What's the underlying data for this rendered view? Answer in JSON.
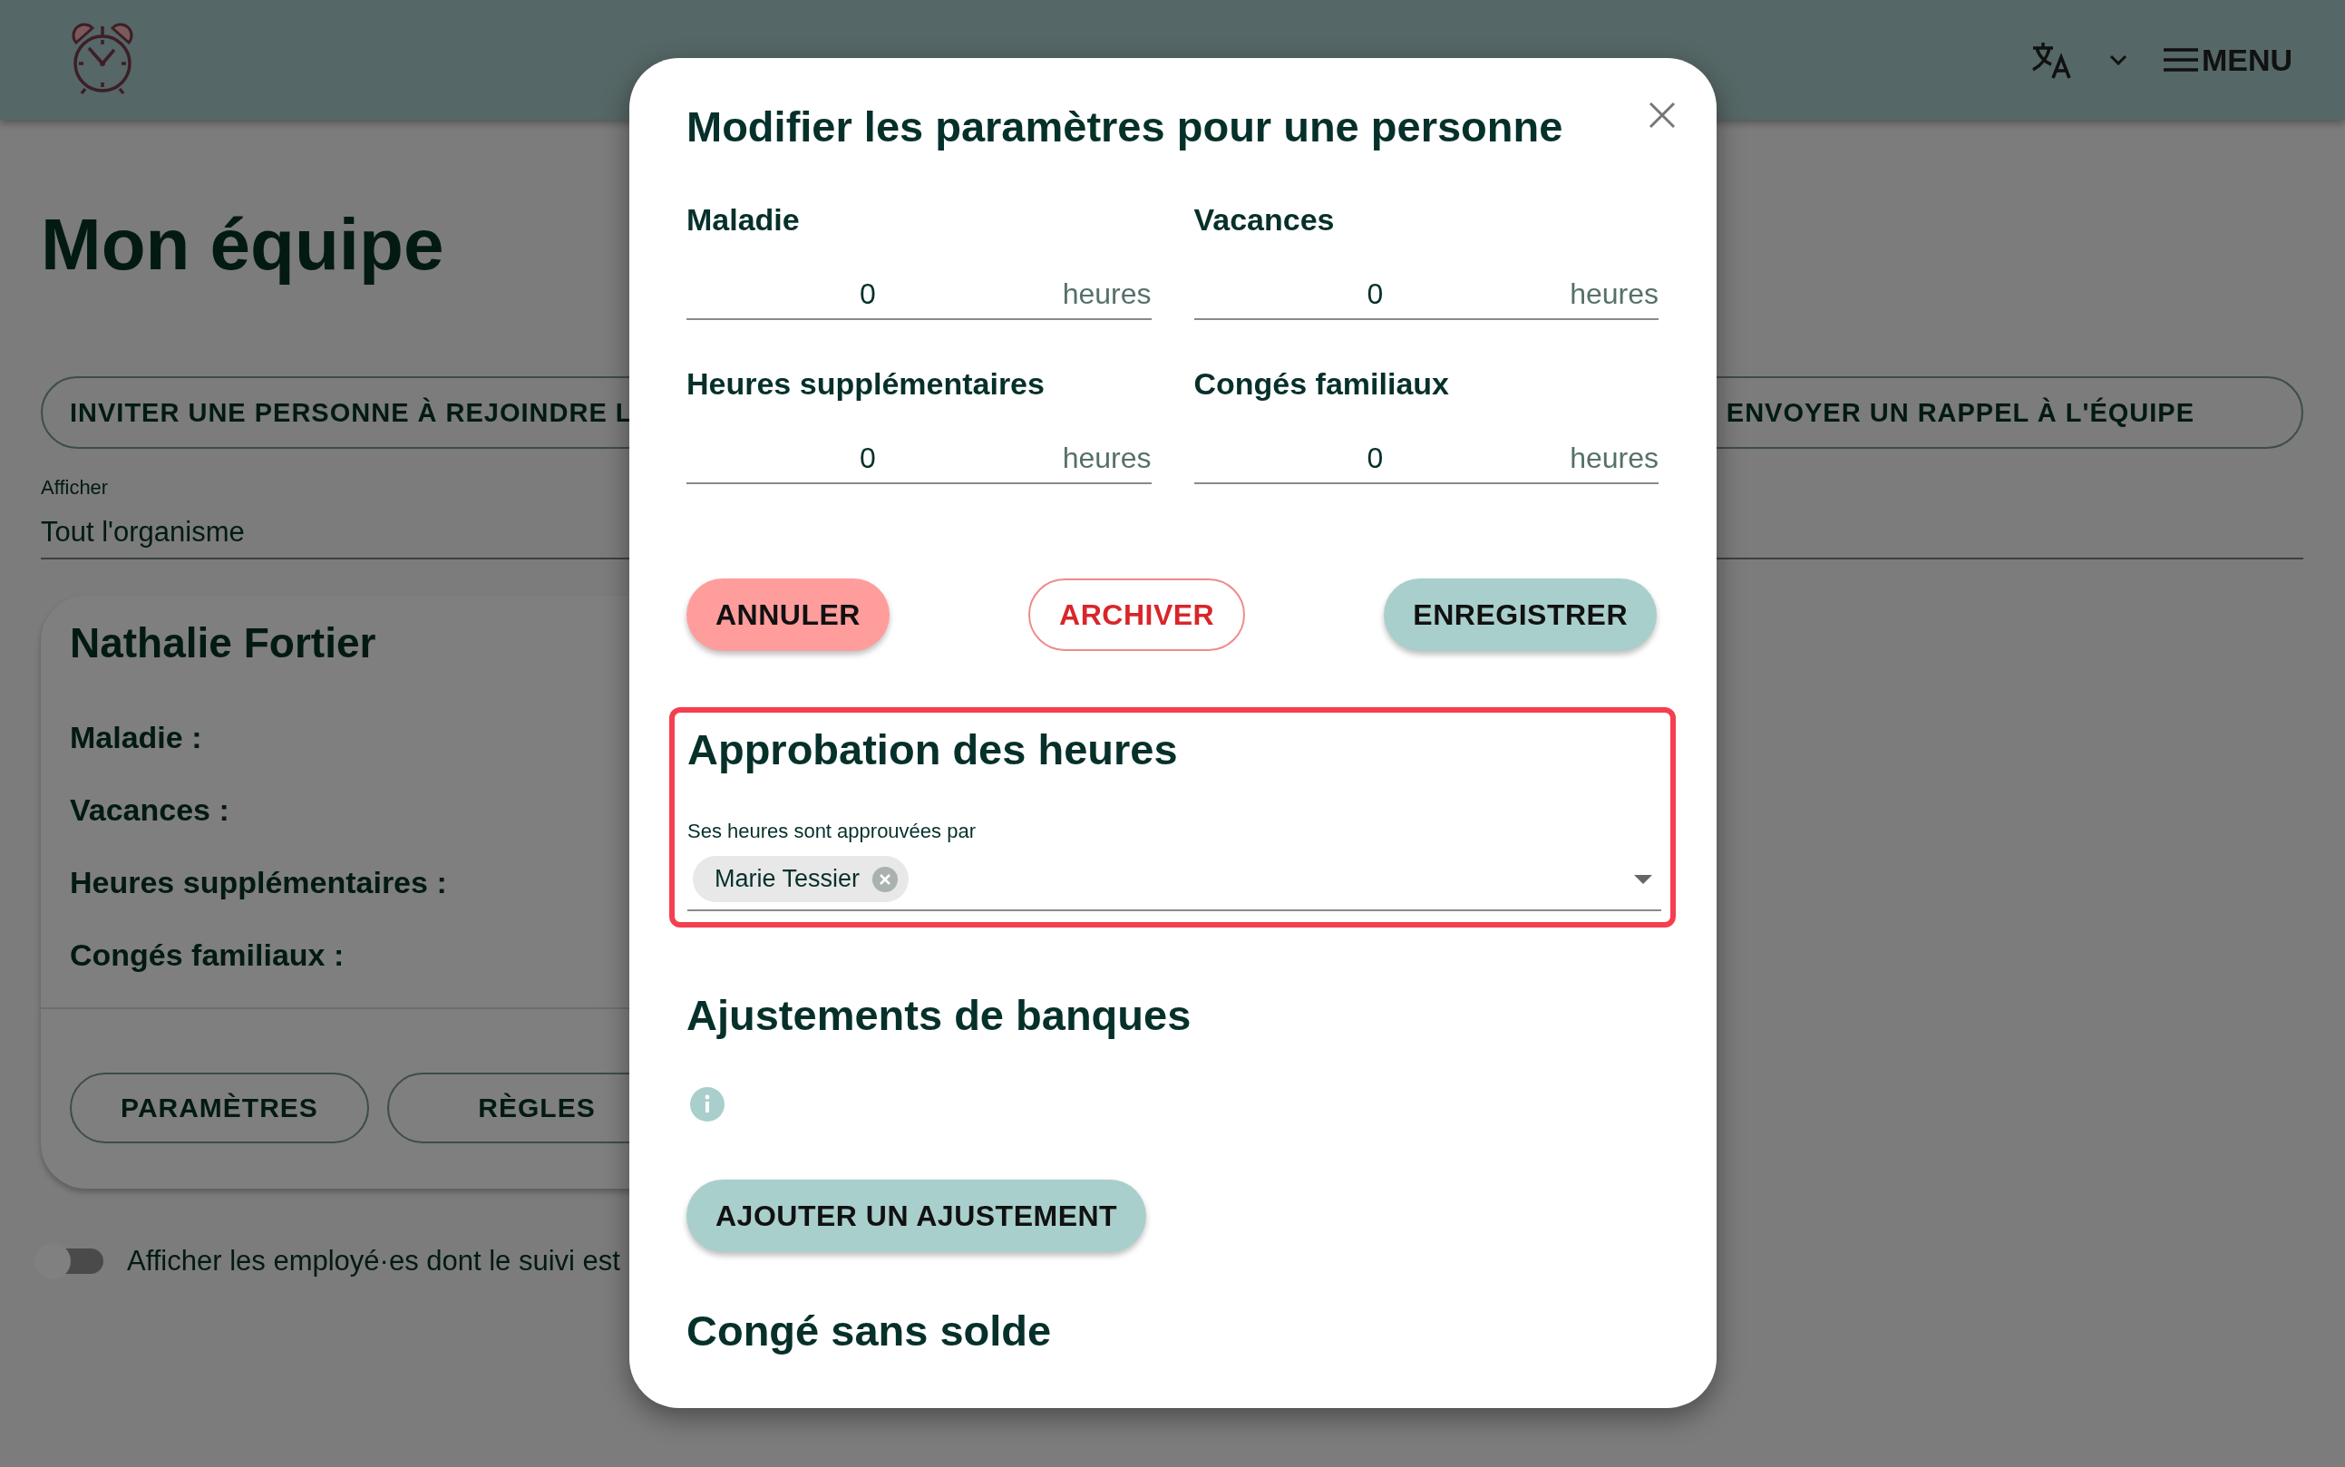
{
  "header": {
    "menu_label": "MENU"
  },
  "page": {
    "title": "Mon équipe",
    "actions": [
      "INVITER UNE PERSONNE À REJOINDRE L",
      "ENVOYER UN RAPPEL À L'ÉQUIPE"
    ],
    "filter": {
      "label": "Afficher",
      "value": "Tout l'organisme"
    },
    "cards": [
      {
        "name": "Nathalie Fortier",
        "banks": [
          "Maladie :",
          "Vacances :",
          "Heures supplémentaires :",
          "Congés familiaux :"
        ],
        "buttons": [
          "PARAMÈTRES",
          "RÈGLES"
        ]
      }
    ],
    "toggle": {
      "label": "Afficher les employé·es dont le suivi est",
      "on": false
    }
  },
  "dialog": {
    "title": "Modifier les paramètres pour une personne",
    "fields": [
      {
        "label": "Maladie",
        "value": "0",
        "unit": "heures"
      },
      {
        "label": "Vacances",
        "value": "0",
        "unit": "heures"
      },
      {
        "label": "Heures supplémentaires",
        "value": "0",
        "unit": "heures"
      },
      {
        "label": "Congés familiaux",
        "value": "0",
        "unit": "heures"
      }
    ],
    "buttons": [
      {
        "label": "ANNULER",
        "kind": "cancel"
      },
      {
        "label": "ARCHIVER",
        "kind": "archive"
      },
      {
        "label": "ENREGISTRER",
        "kind": "save"
      }
    ],
    "approval": {
      "heading": "Approbation des heures",
      "label": "Ses heures sont approuvées par",
      "chips": [
        "Marie Tessier"
      ],
      "highlighted": true
    },
    "adjustments": {
      "heading": "Ajustements de banques",
      "button": "AJOUTER UN AJUSTEMENT"
    },
    "next_heading": "Congé sans solde"
  }
}
